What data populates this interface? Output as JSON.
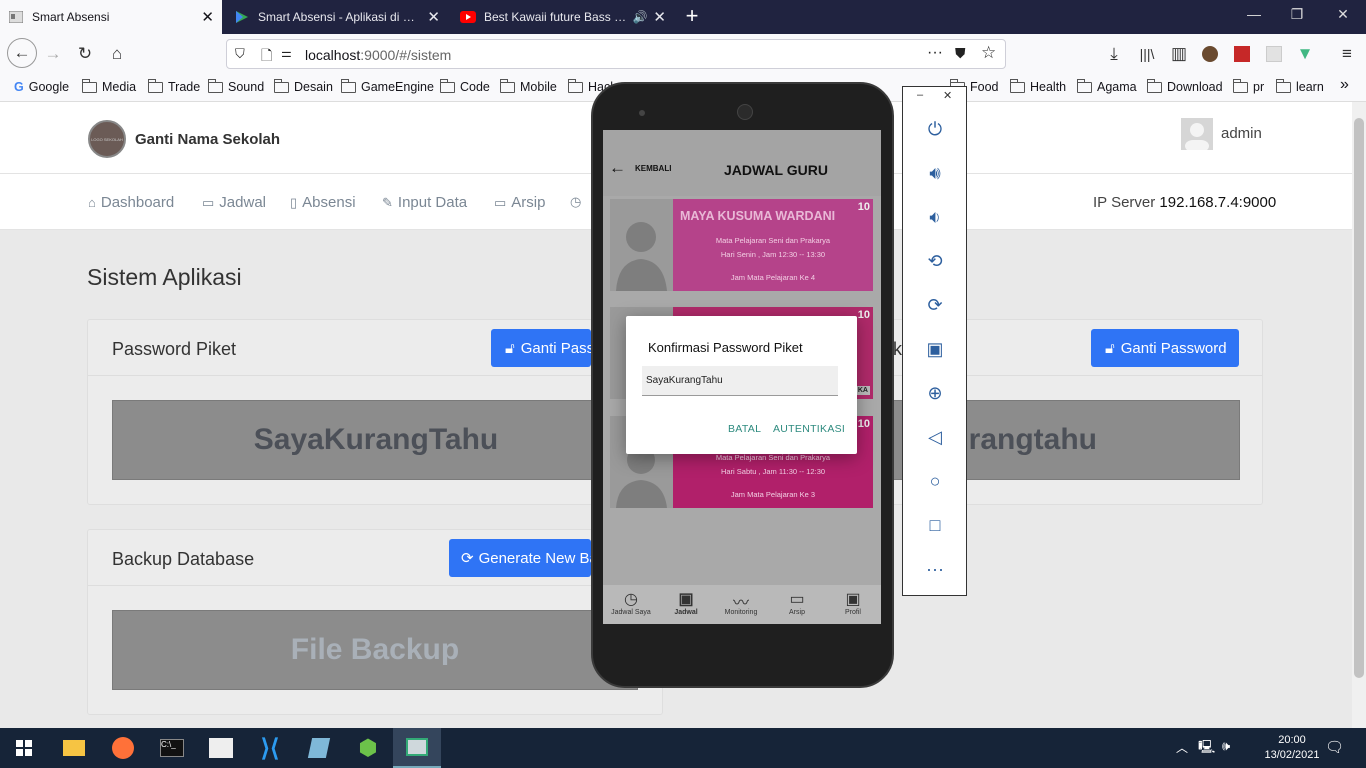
{
  "browser": {
    "tabs": [
      {
        "title": "Smart Absensi",
        "active": true
      },
      {
        "title": "Smart Absensi - Aplikasi di Goo"
      },
      {
        "title": "Best Kawaii future Bass Mix"
      }
    ],
    "url_host": "localhost",
    "url_rest": ":9000/#/sistem",
    "bookmarks": [
      "Google",
      "Media",
      "Trade",
      "Sound",
      "Desain",
      "GameEngine",
      "Code",
      "Mobile",
      "Hack",
      "Food",
      "Health",
      "Agama",
      "Download",
      "pr",
      "learn"
    ]
  },
  "header": {
    "school": "Ganti Nama Sekolah",
    "logo_text": "LOGO SEKOLAH",
    "user": "admin"
  },
  "menu": {
    "items": [
      "Dashboard",
      "Jadwal",
      "Absensi",
      "Input Data",
      "Arsip"
    ],
    "ip_label": "IP Server",
    "ip_value": "192.168.7.4:9000"
  },
  "main": {
    "title": "Sistem Aplikasi",
    "password_card": {
      "title": "Password Piket",
      "button": "Ganti Password",
      "value": "SayaKurangTahu"
    },
    "password_card2": {
      "title_fragment": "k",
      "button": "Ganti Password",
      "value_fragment": "rangtahu"
    },
    "backup_card": {
      "title": "Backup Database",
      "button": "Generate New Ba",
      "box": "File Backup"
    }
  },
  "phone": {
    "header_back": "KEMBALI",
    "header_title": "JADWAL GURU",
    "cards": [
      {
        "name": "MAYA KUSUMA WARDANI",
        "num": "10",
        "line1": "Mata Pelajaran Seni dan Prakarya",
        "line2": "Hari Senin , Jam 12:30 -- 13:30",
        "line3": "Jam Mata Pelajaran Ke 4"
      },
      {
        "num": "10",
        "fragment": "KA"
      },
      {
        "num": "10",
        "line1": "Mata Pelajaran Seni dan Prakarya",
        "line2": "Hari Sabtu , Jam 11:30 -- 12:30",
        "line3": "Jam Mata Pelajaran Ke 3"
      }
    ],
    "dialog": {
      "title": "Konfirmasi Password Piket",
      "input": "SayaKurangTahu",
      "cancel": "BATAL",
      "ok": "AUTENTIKASI"
    },
    "nav": [
      "Jadwal Saya",
      "Jadwal",
      "Monitoring",
      "Arsip",
      "Profil"
    ]
  },
  "taskbar": {
    "time": "20:00",
    "date": "13/02/2021"
  },
  "colors": {
    "primary_button": "#2f74f5",
    "card_pink": "#b5438a",
    "dialog_button": "#2e8b7f"
  }
}
